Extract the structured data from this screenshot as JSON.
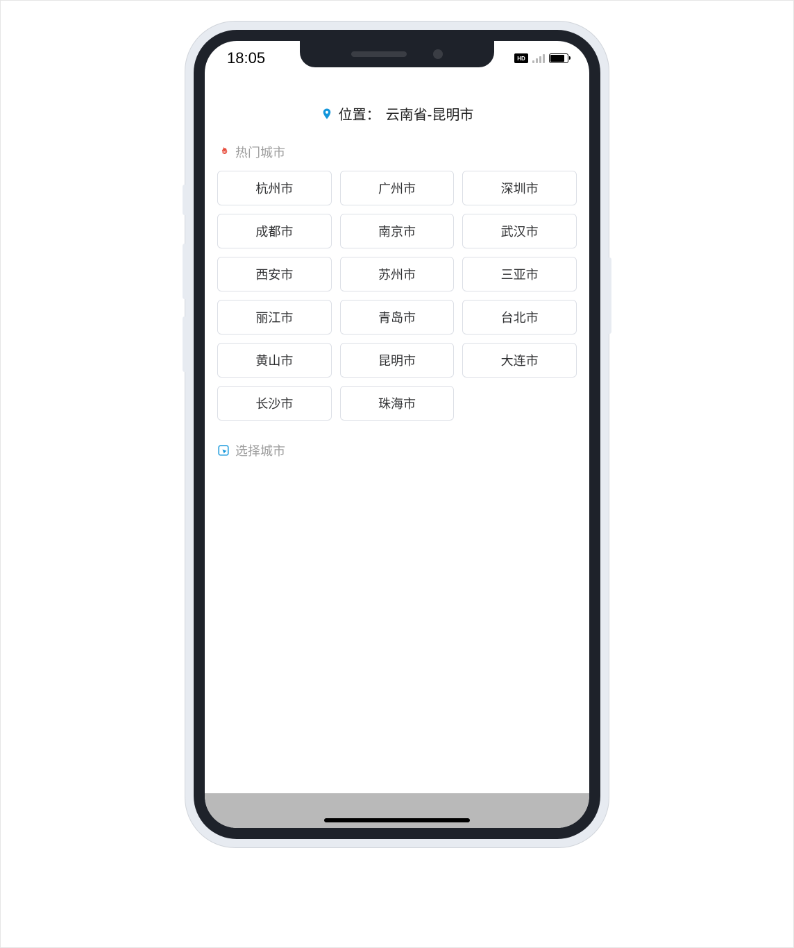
{
  "status": {
    "time": "18:05",
    "hd": "HD"
  },
  "location": {
    "label": "位置：",
    "value": "云南省-昆明市"
  },
  "hot": {
    "title": "热门城市",
    "cities": [
      "杭州市",
      "广州市",
      "深圳市",
      "成都市",
      "南京市",
      "武汉市",
      "西安市",
      "苏州市",
      "三亚市",
      "丽江市",
      "青岛市",
      "台北市",
      "黄山市",
      "昆明市",
      "大连市",
      "长沙市",
      "珠海市"
    ]
  },
  "select": {
    "title": "选择城市"
  }
}
